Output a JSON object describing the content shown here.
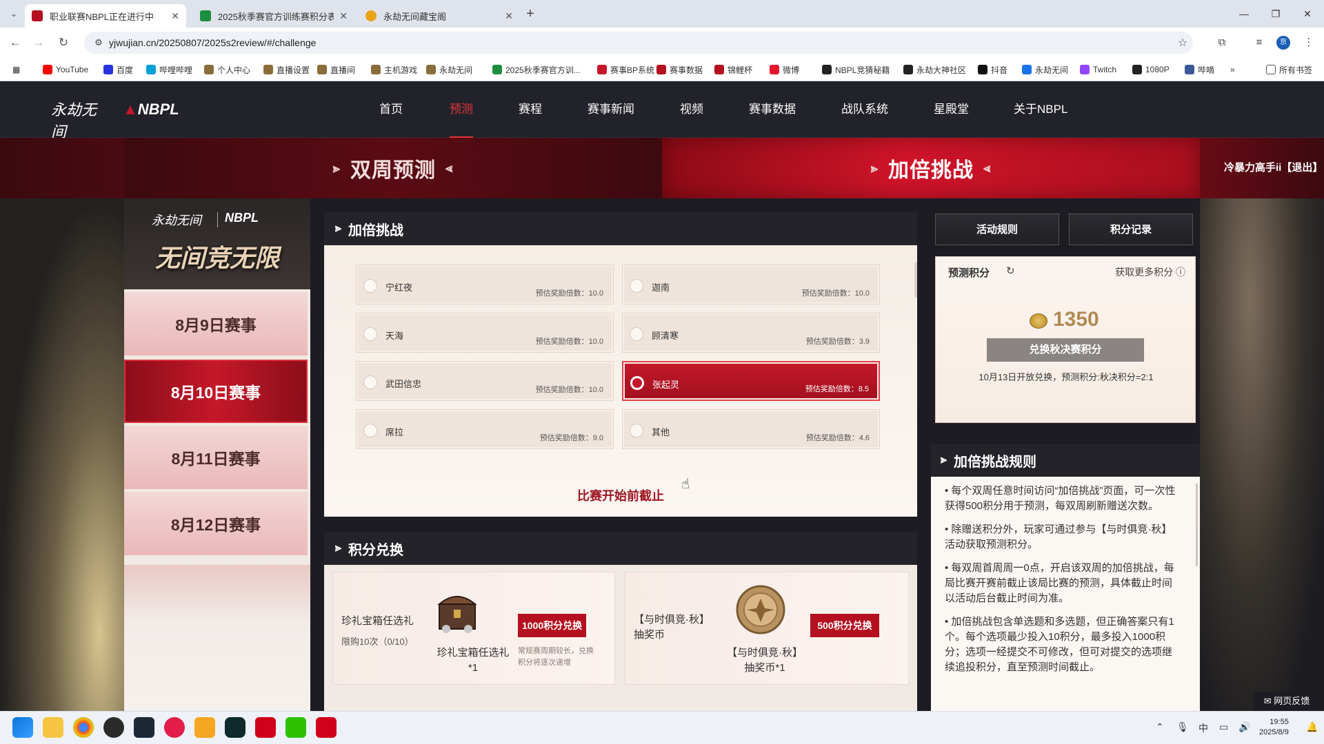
{
  "browser": {
    "tabs": [
      {
        "title": "职业联赛NBPL正在进行中",
        "color": "#b5101f"
      },
      {
        "title": "2025秋季赛官方训练赛积分表",
        "color": "#1e8e3e"
      },
      {
        "title": "永劫无间藏宝阁",
        "color": "#e8a317"
      }
    ],
    "url": "yjwujian.cn/20250807/2025s2review/#/challenge",
    "bookmarks": [
      {
        "label": "YouTube",
        "color": "#ff0000"
      },
      {
        "label": "百度",
        "color": "#2932e1"
      },
      {
        "label": "哔哩哔哩",
        "color": "#00a1d6"
      },
      {
        "label": "个人中心",
        "color": "#8a6d3b"
      },
      {
        "label": "直播设置",
        "color": "#8a6d3b"
      },
      {
        "label": "直播间",
        "color": "#8a6d3b"
      },
      {
        "label": "主机游戏",
        "color": "#8a6d3b"
      },
      {
        "label": "永劫无间",
        "color": "#8a6d3b"
      },
      {
        "label": "2025秋季赛官方训...",
        "color": "#1e8e3e"
      },
      {
        "label": "赛事BP系统",
        "color": "#c4182a"
      },
      {
        "label": "赛事数据",
        "color": "#b5101f"
      },
      {
        "label": "锦鲤杯",
        "color": "#b5101f"
      },
      {
        "label": "微博",
        "color": "#e6162d"
      },
      {
        "label": "NBPL竞猜秘籍",
        "color": "#222222"
      },
      {
        "label": "永劫大神社区",
        "color": "#222222"
      },
      {
        "label": "抖音",
        "color": "#111111"
      },
      {
        "label": "永劫无间",
        "color": "#1a73e8"
      },
      {
        "label": "Twitch",
        "color": "#9146ff"
      },
      {
        "label": "1080P",
        "color": "#222222"
      },
      {
        "label": "哔嘀",
        "color": "#3b5998"
      }
    ],
    "all_bookmarks": "所有书签",
    "avatar": "京"
  },
  "site": {
    "logo_left": "永劫无间",
    "logo_right": "NBPL",
    "nav": [
      {
        "label": "首页",
        "active": false
      },
      {
        "label": "预测",
        "active": true
      },
      {
        "label": "赛程",
        "active": false
      },
      {
        "label": "赛事新闻",
        "active": false
      },
      {
        "label": "视频",
        "active": false
      },
      {
        "label": "赛事数据",
        "active": false
      },
      {
        "label": "战队系统",
        "active": false
      },
      {
        "label": "星殿堂",
        "active": false
      },
      {
        "label": "关于NBPL",
        "active": false
      }
    ],
    "banner_tabs": [
      "双周预测",
      "加倍挑战"
    ],
    "user_status": "冷暴力高手ii【退出】",
    "left_logo_a": "永劫无间",
    "left_logo_b": "NBPL",
    "slogan": "无间竞无限",
    "days": [
      {
        "label": "8月9日赛事",
        "active": false
      },
      {
        "label": "8月10日赛事",
        "active": true
      },
      {
        "label": "8月11日赛事",
        "active": false
      },
      {
        "label": "8月12日赛事",
        "active": false
      }
    ],
    "challenge": {
      "title": "加倍挑战",
      "multiplier_label": "预估奖励倍数：",
      "options": [
        {
          "name": "宁红夜",
          "mult": "10.0",
          "selected": false
        },
        {
          "name": "迦南",
          "mult": "10.0",
          "selected": false
        },
        {
          "name": "天海",
          "mult": "10.0",
          "selected": false
        },
        {
          "name": "顾清寒",
          "mult": "3.9",
          "selected": false
        },
        {
          "name": "武田信忠",
          "mult": "10.0",
          "selected": false
        },
        {
          "name": "张起灵",
          "mult": "8.5",
          "selected": true
        },
        {
          "name": "席拉",
          "mult": "9.0",
          "selected": false
        },
        {
          "name": "其他",
          "mult": "4.6",
          "selected": false
        }
      ],
      "deadline": "比赛开始前截止"
    },
    "exchange": {
      "title": "积分兑换",
      "card1": {
        "title": "珍礼宝箱任选礼",
        "limit": "限购10次（0/10）",
        "caption": "珍礼宝箱任选礼*1",
        "button": "1000积分兑换",
        "note": "常规赛周期较长，兑换积分将逐次递增"
      },
      "card2": {
        "title": "【与时俱竞·秋】抽奖币",
        "caption": "【与时俱竞·秋】抽奖币*1",
        "button": "500积分兑换"
      }
    },
    "side": {
      "rules_button": "活动规则",
      "records_button": "积分记录",
      "score_label": "预测积分",
      "more_label": "获取更多积分",
      "score_value": "1350",
      "exchange_button": "兑换秋决赛积分",
      "exchange_note": "10月13日开放兑换，预测积分:秋决积分=2:1"
    },
    "rules": {
      "title": "加倍挑战规则",
      "items": [
        "• 每个双周任意时间访问“加倍挑战”页面，可一次性获得500积分用于预测，每双周刷新赠送次数。",
        "• 除赠送积分外，玩家可通过参与【与时俱竞·秋】活动获取预测积分。",
        "• 每双周首周周一0点，开启该双周的加倍挑战，每局比赛开赛前截止该局比赛的预测，具体截止时间以活动后台截止时间为准。",
        "• 加倍挑战包含单选题和多选题，但正确答案只有1个。每个选项最少投入10积分，最多投入1000积分；选项一经提交不可修改，但可对提交的选项继续追投积分，直至预测时间截止。"
      ]
    },
    "feedback": "网页反馈"
  },
  "taskbar": {
    "time": "19:55",
    "date": "2025/8/9",
    "ime": "中"
  }
}
